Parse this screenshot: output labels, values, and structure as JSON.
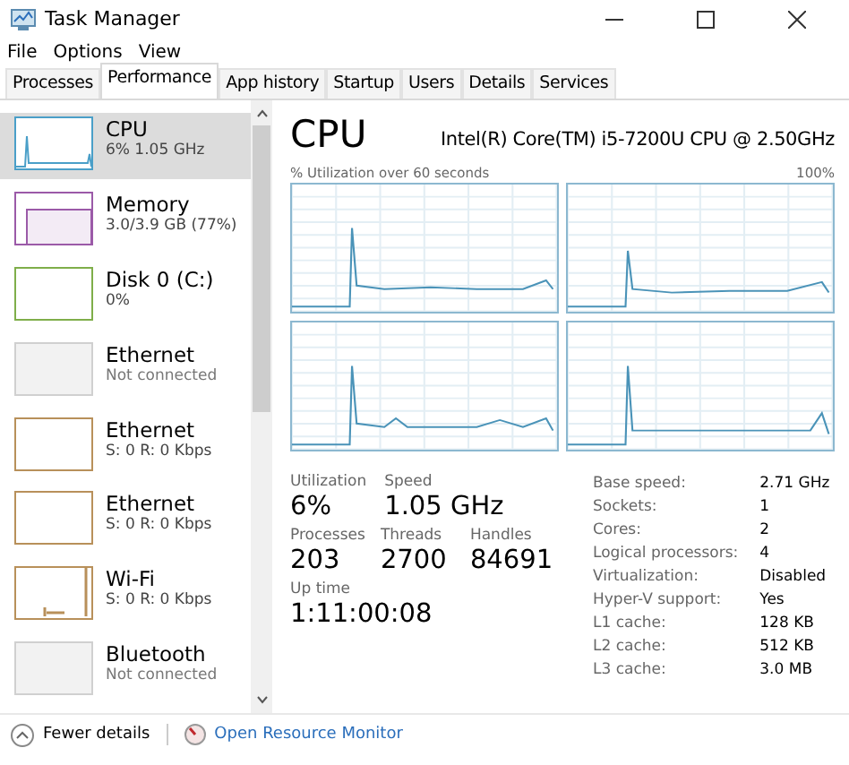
{
  "window": {
    "title": "Task Manager"
  },
  "menu": [
    "File",
    "Options",
    "View"
  ],
  "tabs": [
    {
      "label": "Processes",
      "selected": false
    },
    {
      "label": "Performance",
      "selected": true
    },
    {
      "label": "App history",
      "selected": false
    },
    {
      "label": "Startup",
      "selected": false
    },
    {
      "label": "Users",
      "selected": false
    },
    {
      "label": "Details",
      "selected": false
    },
    {
      "label": "Services",
      "selected": false
    }
  ],
  "sidebar": {
    "items": [
      {
        "name": "CPU",
        "detail": "6% 1.05 GHz",
        "selected": true,
        "color": "#4a9fc8",
        "kind": "spike"
      },
      {
        "name": "Memory",
        "detail": "3.0/3.9 GB (77%)",
        "selected": false,
        "color": "#9b5aa8",
        "kind": "memory"
      },
      {
        "name": "Disk 0 (C:)",
        "detail": "0%",
        "selected": false,
        "color": "#7fae4a",
        "kind": "empty"
      },
      {
        "name": "Ethernet",
        "detail": "Not connected",
        "selected": false,
        "color": "#d0d0d0",
        "kind": "inactive"
      },
      {
        "name": "Ethernet",
        "detail": "S: 0 R: 0 Kbps",
        "selected": false,
        "color": "#b8905a",
        "kind": "empty"
      },
      {
        "name": "Ethernet",
        "detail": "S: 0 R: 0 Kbps",
        "selected": false,
        "color": "#b8905a",
        "kind": "empty"
      },
      {
        "name": "Wi-Fi",
        "detail": "S: 0 R: 0 Kbps",
        "selected": false,
        "color": "#b8905a",
        "kind": "wifi"
      },
      {
        "name": "Bluetooth",
        "detail": "Not connected",
        "selected": false,
        "color": "#d0d0d0",
        "kind": "inactive"
      }
    ]
  },
  "detail": {
    "title": "CPU",
    "model": "Intel(R) Core(TM) i5-7200U CPU @ 2.50GHz",
    "graph_caption": "% Utilization over 60 seconds",
    "graph_max": "100%",
    "stats": [
      [
        {
          "label": "Utilization",
          "value": "6%"
        },
        {
          "label": "Speed",
          "value": "1.05 GHz"
        }
      ],
      [
        {
          "label": "Processes",
          "value": "203"
        },
        {
          "label": "Threads",
          "value": "2700"
        },
        {
          "label": "Handles",
          "value": "84691"
        }
      ],
      [
        {
          "label": "Up time",
          "value": "1:11:00:08"
        }
      ]
    ],
    "specs": [
      {
        "label": "Base speed:",
        "value": "2.71 GHz"
      },
      {
        "label": "Sockets:",
        "value": "1"
      },
      {
        "label": "Cores:",
        "value": "2"
      },
      {
        "label": "Logical processors:",
        "value": "4"
      },
      {
        "label": "Virtualization:",
        "value": "Disabled"
      },
      {
        "label": "Hyper-V support:",
        "value": "Yes"
      },
      {
        "label": "L1 cache:",
        "value": "128 KB"
      },
      {
        "label": "L2 cache:",
        "value": "512 KB"
      },
      {
        "label": "L3 cache:",
        "value": "3.0 MB"
      }
    ]
  },
  "footer": {
    "fewer_details": "Fewer details",
    "resource_monitor": "Open Resource Monitor"
  }
}
